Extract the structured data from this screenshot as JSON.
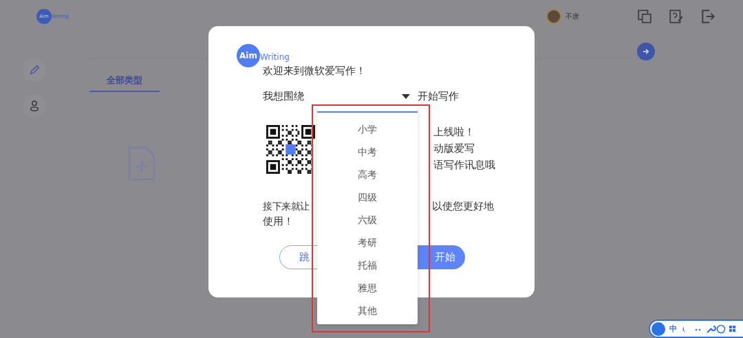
{
  "header": {
    "logo_badge": "Aim",
    "logo_word": "Writing",
    "user_name": "不唐"
  },
  "tabs": [
    {
      "label": "全部类型",
      "selected": true
    }
  ],
  "modal": {
    "logo_badge": "Aim",
    "logo_word": "Writing",
    "welcome": "欢迎来到微软爱写作！",
    "prompt_label": "我想围绕",
    "prompt_suffix": "开始写作",
    "qr_lines": [
      "上线啦！",
      "动版爱写",
      "语写作讯息哦"
    ],
    "intro_start": "接下来就让",
    "intro_end": "以使您更好地",
    "intro_line2": "使用！",
    "buttons": [
      {
        "label": "跳",
        "kind": "outline"
      },
      {
        "label": "开始",
        "kind": "primary"
      }
    ]
  },
  "dropdown": {
    "options": [
      {
        "label": "小学",
        "selected": false
      },
      {
        "label": "中考",
        "selected": false
      },
      {
        "label": "高考",
        "selected": false
      },
      {
        "label": "四级",
        "selected": false
      },
      {
        "label": "六级",
        "selected": false
      },
      {
        "label": "考研",
        "selected": false
      },
      {
        "label": "托福",
        "selected": false
      },
      {
        "label": "雅思",
        "selected": false
      },
      {
        "label": "其他",
        "selected": false
      }
    ]
  },
  "ime": {
    "label": "中"
  }
}
